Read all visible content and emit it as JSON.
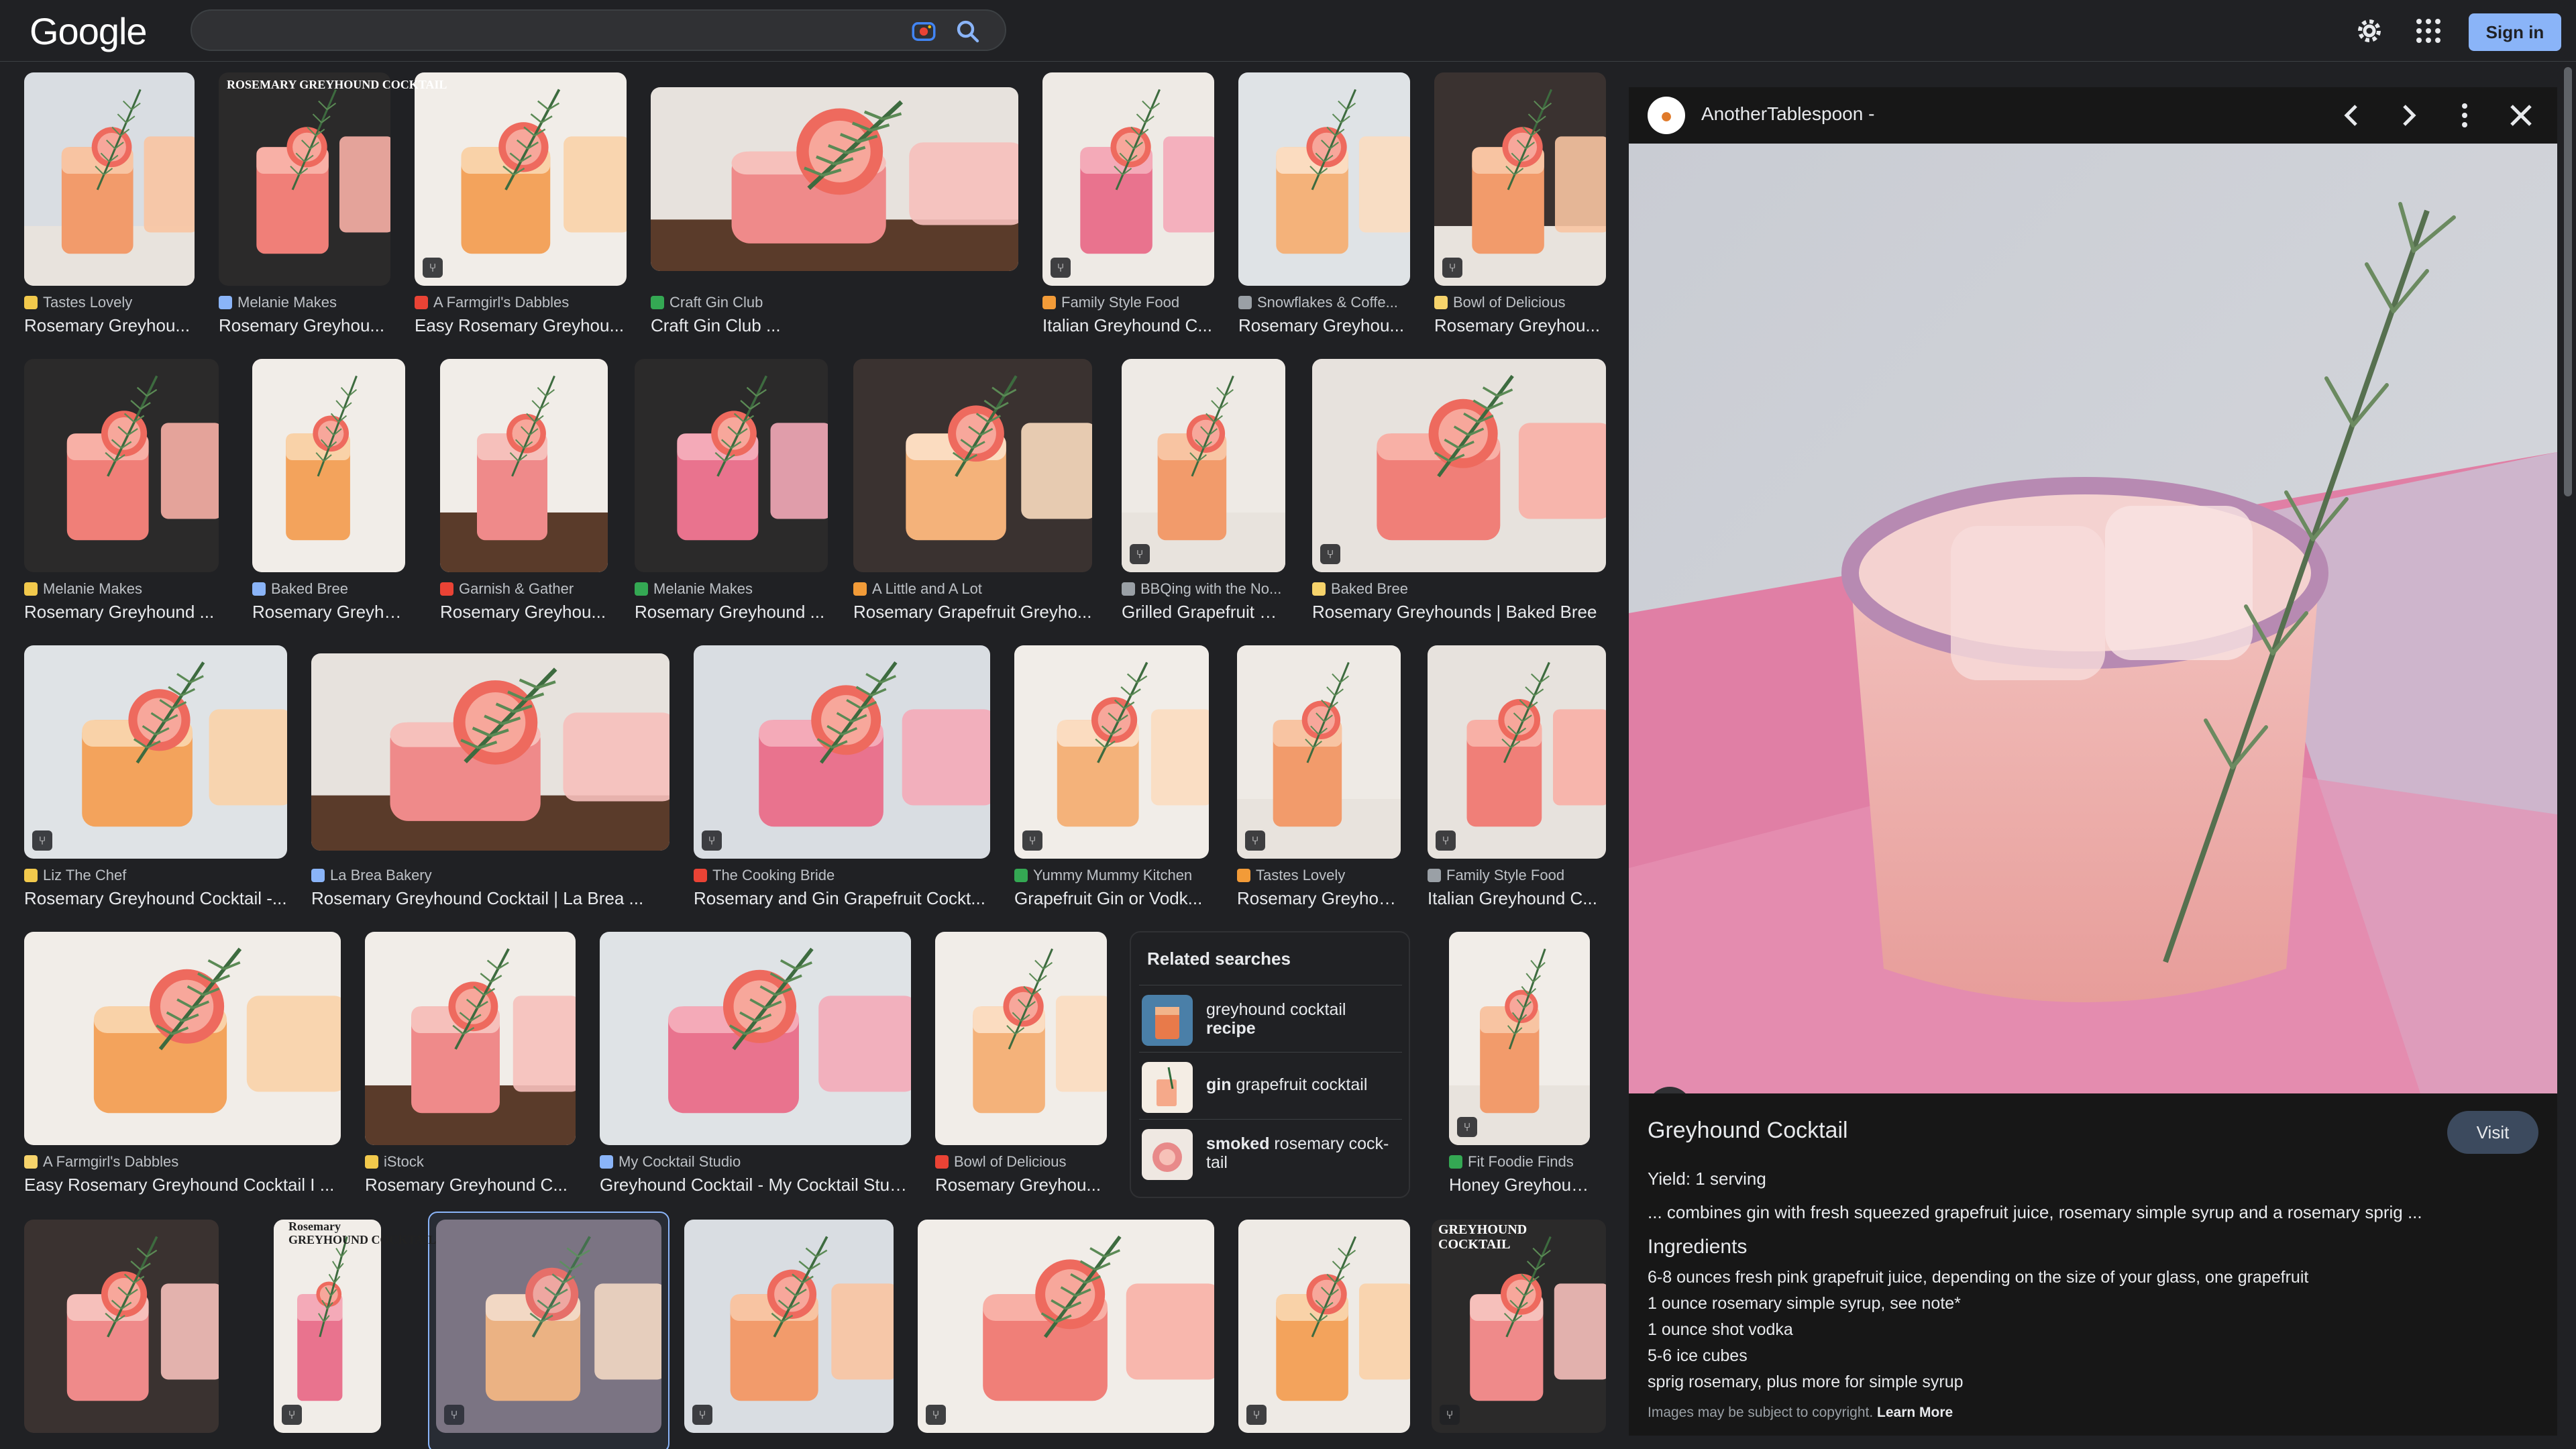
{
  "header": {
    "logo": "Google",
    "search_value": "",
    "signin_label": "Sign in"
  },
  "colors": {
    "background": "#202124",
    "accent": "#8ab4f8",
    "panel": "#171717"
  },
  "icons": {
    "lens": "google-lens-icon",
    "search": "search-icon",
    "settings": "gear-icon",
    "apps": "apps-grid-icon",
    "recipe_badge": "fork-knife-icon"
  },
  "results": [
    {
      "source": "Tastes Lovely",
      "title": "Rosemary Greyhou..."
    },
    {
      "source": "Melanie Makes",
      "title": "Rosemary Greyhou..."
    },
    {
      "source": "A Farmgirl's Dabbles",
      "title": "Easy Rosemary Greyhou..."
    },
    {
      "source": "Craft Gin Club",
      "title": "Craft Gin Club ..."
    },
    {
      "source": "Family Style Food",
      "title": "Italian Greyhound C..."
    },
    {
      "source": "Snowflakes & Coffe...",
      "title": "Rosemary Greyhou..."
    },
    {
      "source": "Bowl of Delicious",
      "title": "Rosemary Greyhou..."
    },
    {
      "source": "Melanie Makes",
      "title": "Rosemary Greyhound ..."
    },
    {
      "source": "Baked Bree",
      "title": "Rosemary Greyhou..."
    },
    {
      "source": "Garnish & Gather",
      "title": "Rosemary Greyhou..."
    },
    {
      "source": "Melanie Makes",
      "title": "Rosemary Greyhound ..."
    },
    {
      "source": "A Little and A Lot",
      "title": "Rosemary Grapefruit Greyho..."
    },
    {
      "source": "BBQing with the No...",
      "title": "Grilled Grapefruit G..."
    },
    {
      "source": "Baked Bree",
      "title": "Rosemary Greyhounds | Baked Bree"
    },
    {
      "source": "Liz The Chef",
      "title": "Rosemary Greyhound Cocktail -..."
    },
    {
      "source": "La Brea Bakery",
      "title": "Rosemary Greyhound Cocktail | La Brea ..."
    },
    {
      "source": "The Cooking Bride",
      "title": "Rosemary and Gin Grapefruit Cockt..."
    },
    {
      "source": "Yummy Mummy Kitchen",
      "title": "Grapefruit Gin or Vodk..."
    },
    {
      "source": "Tastes Lovely",
      "title": "Rosemary Greyhou..."
    },
    {
      "source": "Family Style Food",
      "title": "Italian Greyhound C..."
    },
    {
      "source": "A Farmgirl's Dabbles",
      "title": "Easy Rosemary Greyhound Cocktail I ..."
    },
    {
      "source": "iStock",
      "title": "Rosemary Greyhound C..."
    },
    {
      "source": "My Cocktail Studio",
      "title": "Greyhound Cocktail - My Cocktail Stud..."
    },
    {
      "source": "Bowl of Delicious",
      "title": "Rosemary Greyhou..."
    },
    {
      "source": "Fit Foodie Finds",
      "title": "Honey Greyhound ..."
    }
  ],
  "thumb_texts": {
    "melanie_overlay": "ROSEMARY GREYHOUND COCKTAIL",
    "pin_top": "Rosemary",
    "pin_bottom": "GREYHOUND COCKTAIL",
    "garnish_overlay_1": "GREYHOUND",
    "garnish_overlay_2": "COCKTAIL"
  },
  "related": {
    "title": "Related searches",
    "items": [
      {
        "normal": "greyhound cocktail",
        "bold": "recipe"
      },
      {
        "bold": "gin",
        "normal": " grapefruit cocktail"
      },
      {
        "bold": "smoked",
        "normal": " rosemary cock-tail"
      }
    ]
  },
  "panel": {
    "source": "AnotherTablespoon -",
    "title": "Greyhound Cocktail",
    "visit_label": "Visit",
    "yield": "Yield: 1 serving",
    "snippet": "... combines gin with fresh squeezed grapefruit juice, rosemary simple syrup and a rosemary sprig ...",
    "ingredients_heading": "Ingredients",
    "ingredients": [
      "6-8 ounces fresh pink grapefruit juice, depending on the size of your glass, one grapefruit",
      "1 ounce rosemary simple syrup, see note*",
      "1 ounce shot vodka",
      "5-6 ice cubes",
      "sprig rosemary, plus more for simple syrup"
    ],
    "copyright": "Images may be subject to copyright.",
    "learn_more": "Learn More"
  }
}
